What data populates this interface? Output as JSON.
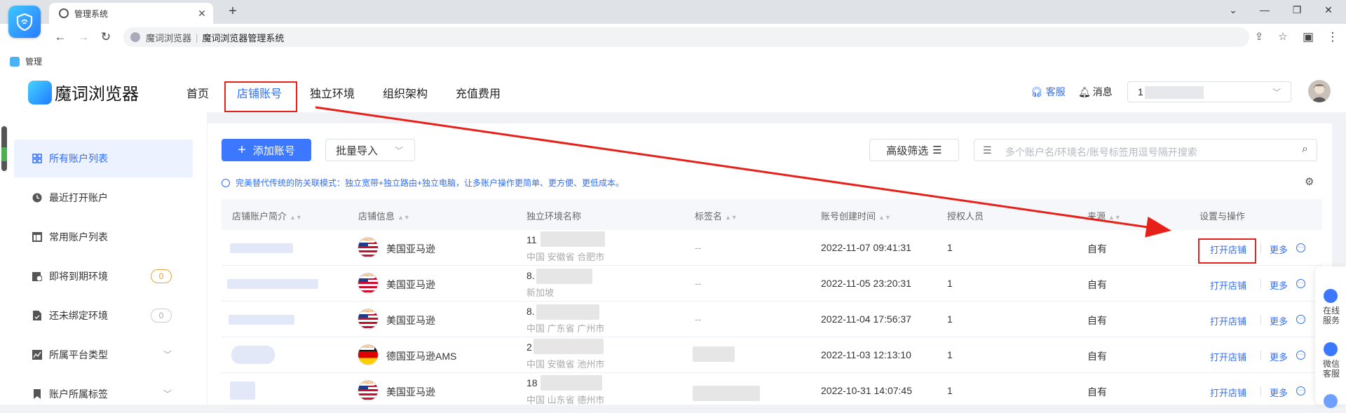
{
  "browser": {
    "tab_title": "管理系统",
    "close_glyph": "✕",
    "new_tab_glyph": "+",
    "address_site": "魔词浏览器",
    "address_sep": "|",
    "address_page": "魔词浏览器管理系统",
    "bookmark": "管理",
    "icons": [
      "back-icon",
      "forward-icon",
      "reload-icon",
      "share-icon",
      "star-icon",
      "sidebar-icon",
      "menu-icon"
    ]
  },
  "header": {
    "brand": "魔词浏览器",
    "nav": [
      "首页",
      "店铺账号",
      "独立环境",
      "组织架构",
      "充值费用"
    ],
    "active_nav": "店铺账号",
    "service": "客服",
    "messages": "消息",
    "account_value": "1"
  },
  "sidebar": {
    "items": [
      {
        "label": "所有账户列表",
        "icon": "grid-icon",
        "active": true
      },
      {
        "label": "最近打开账户",
        "icon": "clock-icon"
      },
      {
        "label": "常用账户列表",
        "icon": "table-icon"
      },
      {
        "label": "即将到期环境",
        "icon": "expiring-icon",
        "badge": "0"
      },
      {
        "label": "还未绑定环境",
        "icon": "unbound-icon",
        "badge": "0"
      },
      {
        "label": "所属平台类型",
        "icon": "platform-icon",
        "expandable": true
      },
      {
        "label": "账户所属标签",
        "icon": "bookmark-icon",
        "expandable": true
      }
    ]
  },
  "toolbar": {
    "add_account": "添加账号",
    "batch_import": "批量导入",
    "advanced_filter": "高级筛选",
    "search_placeholder": "多个账户名/环境名/账号标签用逗号隔开搜索"
  },
  "notice": "完美替代传统的防关联模式：独立宽带+独立路由+独立电脑，让多账户操作更简单、更方便、更低成本。",
  "table": {
    "columns": [
      "店铺账户简介",
      "店铺信息",
      "独立环境名称",
      "标签名",
      "账号创建时间",
      "授权人员",
      "来源",
      "设置与操作"
    ],
    "rows": [
      {
        "store": "美国亚马逊",
        "flag": "us",
        "env": "11",
        "location": "中国 安徽省 合肥市",
        "tag": "--",
        "created": "2022-11-07 09:41:31",
        "auth": "1",
        "source": "自有"
      },
      {
        "store": "美国亚马逊",
        "flag": "us",
        "env": "8.",
        "location": "新加坡",
        "tag": "--",
        "created": "2022-11-05 23:20:31",
        "auth": "1",
        "source": "自有"
      },
      {
        "store": "美国亚马逊",
        "flag": "us",
        "env": "8.",
        "location": "中国 广东省 广州市",
        "tag": "--",
        "created": "2022-11-04 17:56:37",
        "auth": "1",
        "source": "自有"
      },
      {
        "store": "德国亚马逊AMS",
        "flag": "de",
        "env": "2",
        "location": "中国 安徽省 池州市",
        "tag": "",
        "created": "2022-11-03 12:13:10",
        "auth": "1",
        "source": "自有"
      },
      {
        "store": "美国亚马逊",
        "flag": "us",
        "env": "18",
        "location": "中国 山东省 德州市",
        "tag": "",
        "created": "2022-10-31 14:07:45",
        "auth": "1",
        "source": "自有"
      }
    ],
    "open_store": "打开店铺",
    "more": "更多",
    "amazon_tag": "amazon"
  },
  "float_panel": {
    "online_service": "在线服务",
    "wechat_service": "微信客服"
  },
  "colors": {
    "accent": "#3c78ff",
    "annotation_red": "#e8201a",
    "badge_orange": "#e6a23c"
  }
}
